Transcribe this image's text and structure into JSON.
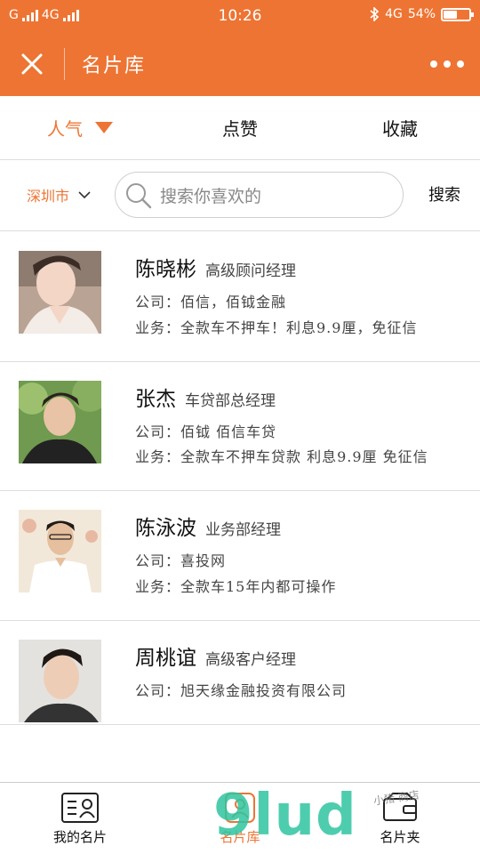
{
  "status_bar": {
    "carrier_left": "G",
    "network_left": "4G",
    "time": "10:26",
    "network_right": "4G",
    "battery": "54%",
    "battery_level": 0.54
  },
  "title_bar": {
    "title": "名片库"
  },
  "tabs": [
    {
      "label": "人气",
      "active": true
    },
    {
      "label": "点赞",
      "active": false
    },
    {
      "label": "收藏",
      "active": false
    }
  ],
  "search": {
    "city": "深圳市",
    "placeholder": "搜索你喜欢的",
    "button": "搜索"
  },
  "cards": [
    {
      "name": "陈晓彬",
      "title": "高级顾问经理",
      "company": "公司：佰信，佰钺金融",
      "business": "业务：全款车不押车！利息9.9厘，免征信"
    },
    {
      "name": "张杰",
      "title": "车贷部总经理",
      "company": "公司：佰钺 佰信车贷",
      "business": "业务：全款车不押车贷款 利息9.9厘 免征信"
    },
    {
      "name": "陈泳波",
      "title": "业务部经理",
      "company": "公司：喜投网",
      "business": "业务：全款车15年内都可操作"
    },
    {
      "name": "周桃谊",
      "title": "高级客户经理",
      "company": "公司：旭天缘金融投资有限公司",
      "business": ""
    }
  ],
  "bottom_nav": [
    {
      "label": "我的名片",
      "icon": "id-card-icon",
      "active": false
    },
    {
      "label": "名片库",
      "icon": "card-library-icon",
      "active": true
    },
    {
      "label": "名片夹",
      "icon": "card-holder-icon",
      "active": false
    }
  ],
  "watermark": {
    "text": "9lud",
    "small_text": "小猪 商店"
  },
  "colors": {
    "brand": "#ee7433",
    "watermark": "#2ec4a0"
  }
}
